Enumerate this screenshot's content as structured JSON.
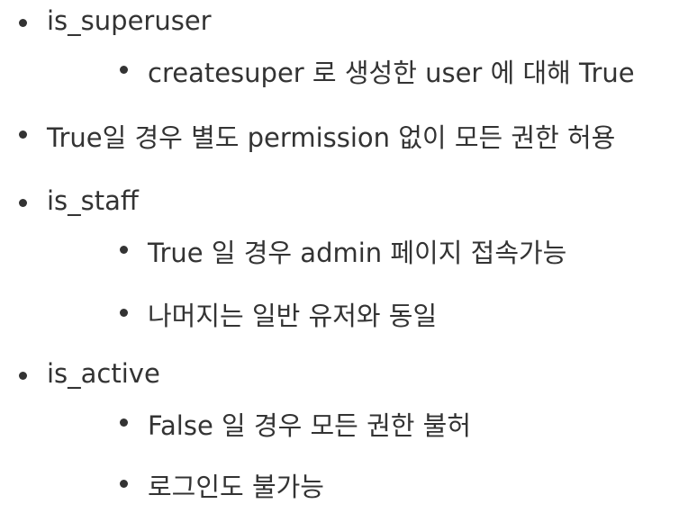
{
  "items": [
    "is_superuser",
    "createsuper 로 생성한 user 에 대해 True",
    "True일 경우 별도 permission 없이 모든 권한 허용",
    "is_staff",
    "True 일 경우 admin 페이지 접속가능",
    "나머지는 일반 유저와 동일",
    "is_active",
    "False 일 경우 모든 권한 불허",
    "로그인도 불가능"
  ]
}
